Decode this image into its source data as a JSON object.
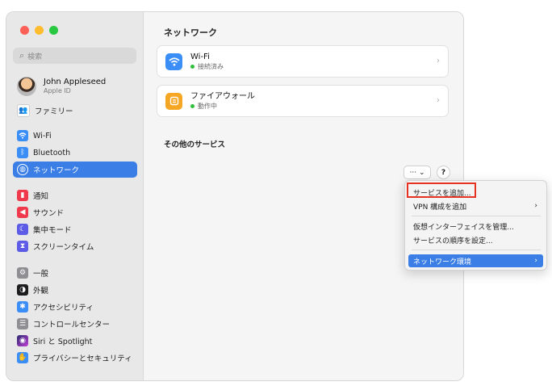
{
  "window": {
    "traffic_colors": [
      "#fe5f57",
      "#febc2e",
      "#28c840"
    ]
  },
  "sidebar": {
    "search_placeholder": "検索",
    "profile": {
      "name": "John Appleseed",
      "subtitle": "Apple ID"
    },
    "items": [
      {
        "label": "ファミリー",
        "icon": "family-icon",
        "color": "#ffffff"
      },
      {
        "label": "Wi-Fi",
        "icon": "wifi-icon",
        "color": "#3a8ef6"
      },
      {
        "label": "Bluetooth",
        "icon": "bluetooth-icon",
        "color": "#3a8ef6"
      },
      {
        "label": "ネットワーク",
        "icon": "globe-icon",
        "color": "#3a8ef6",
        "active": true
      },
      {
        "label": "通知",
        "icon": "bell-icon",
        "color": "#f0394c"
      },
      {
        "label": "サウンド",
        "icon": "speaker-icon",
        "color": "#f0394c"
      },
      {
        "label": "集中モード",
        "icon": "moon-icon",
        "color": "#5e5ce6"
      },
      {
        "label": "スクリーンタイム",
        "icon": "hourglass-icon",
        "color": "#5e5ce6"
      },
      {
        "label": "一般",
        "icon": "gear-icon",
        "color": "#8e8e93"
      },
      {
        "label": "外観",
        "icon": "appearance-icon",
        "color": "#1d1d1f"
      },
      {
        "label": "アクセシビリティ",
        "icon": "accessibility-icon",
        "color": "#3a8ef6"
      },
      {
        "label": "コントロールセンター",
        "icon": "control-center-icon",
        "color": "#8e8e93"
      },
      {
        "label": "Siri と Spotlight",
        "icon": "siri-icon",
        "color": "#2b2b6e"
      },
      {
        "label": "プライバシーとセキュリティ",
        "icon": "hand-icon",
        "color": "#3a8ef6"
      }
    ]
  },
  "main": {
    "title": "ネットワーク",
    "services": [
      {
        "name": "Wi-Fi",
        "status": "接続済み",
        "icon": "wifi-icon",
        "color": "#3a8ef6"
      },
      {
        "name": "ファイアウォール",
        "status": "動作中",
        "icon": "firewall-icon",
        "color": "#f5a623"
      }
    ],
    "other_services": "その他のサービス",
    "more_button": "··· ⌄",
    "help_button": "?"
  },
  "menu": {
    "items": [
      {
        "label": "サービスを追加...",
        "submenu": false
      },
      {
        "label": "VPN 構成を追加",
        "submenu": true
      },
      {
        "label": "仮想インターフェイスを管理...",
        "submenu": false
      },
      {
        "label": "サービスの順序を設定...",
        "submenu": false
      },
      {
        "label": "ネットワーク環境",
        "submenu": true,
        "highlighted": true
      }
    ],
    "submenu_arrow": "›",
    "highlight_color": "#3a7ee6",
    "annotation_color": "#e53223"
  }
}
